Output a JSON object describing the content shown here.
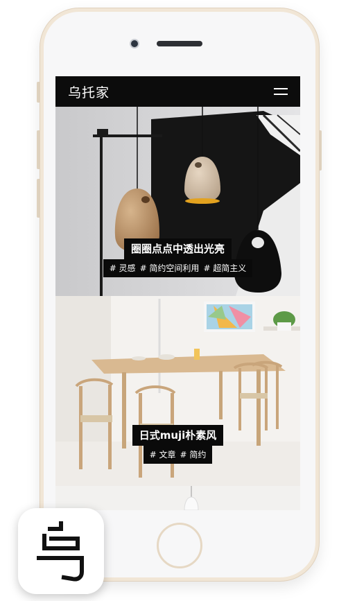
{
  "app": {
    "brand": "乌托家",
    "menu_icon": "hamburger-menu-icon"
  },
  "feed": [
    {
      "title": "圈圈点点中透出光亮",
      "tags": [
        "# 灵感",
        "# 简约空间利用",
        "# 超简主义"
      ]
    },
    {
      "title": "日式muji朴素风",
      "tags": [
        "# 文章",
        "# 简约"
      ]
    }
  ],
  "colors": {
    "topbar": "#0c0c0c",
    "phone_frame": "#f1e6d6",
    "caption_bg": "#0a0a0a",
    "caption_text": "#ffffff"
  },
  "app_icon": {
    "glyph": "乌",
    "name": "wutuojia-app-icon"
  }
}
